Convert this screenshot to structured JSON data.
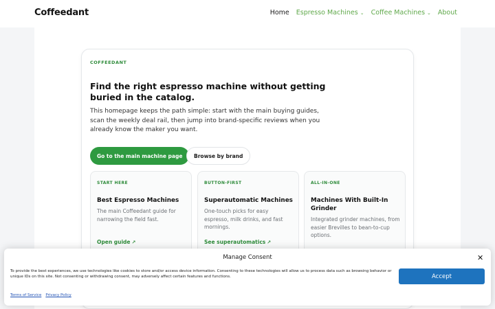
{
  "header": {
    "logo": "Coffeedant",
    "nav": [
      {
        "label": "Home",
        "active": true,
        "dropdown": false
      },
      {
        "label": "Espresso Machines",
        "active": false,
        "dropdown": true
      },
      {
        "label": "Coffee Machines",
        "active": false,
        "dropdown": true
      },
      {
        "label": "About",
        "active": false,
        "dropdown": false
      }
    ]
  },
  "hero": {
    "eyebrow": "COFFEEDANT",
    "title": "Find the right espresso machine without getting buried in the catalog.",
    "description": "This homepage keeps the path simple: start with the main buying guides, scan the weekly deal rail, then jump into brand-specific reviews when you already know the maker you want.",
    "primary_button": "Go to the main machine page",
    "secondary_button": "Browse by brand"
  },
  "cards": [
    {
      "eyebrow": "START HERE",
      "title": "Best Espresso Machines",
      "description": "The main Coffeedant guide for narrowing the field fast.",
      "link": "Open guide"
    },
    {
      "eyebrow": "BUTTON-FIRST",
      "title": "Superautomatic Machines",
      "description": "One-touch picks for easy espresso, milk drinks, and fast mornings.",
      "link": "See superautomatics"
    },
    {
      "eyebrow": "ALL-IN-ONE",
      "title": "Machines With Built-In Grinder",
      "description": "Integrated grinder machines, from easier Brevilles to bean-to-cup options.",
      "link": ""
    }
  ],
  "consent": {
    "title": "Manage Consent",
    "text": "To provide the best experiences, we use technologies like cookies to store and/or access device information. Consenting to these technologies will allow us to process data such as browsing behavior or unique IDs on this site. Not consenting or withdrawing consent, may adversely affect certain features and functions.",
    "accept_label": "Accept",
    "close_glyph": "✕",
    "links": [
      "Terms of Service",
      "Privacy Policy"
    ]
  },
  "colors": {
    "accent_green": "#2e9a40",
    "link_green": "#5fa84a",
    "accept_blue": "#1e73be"
  }
}
